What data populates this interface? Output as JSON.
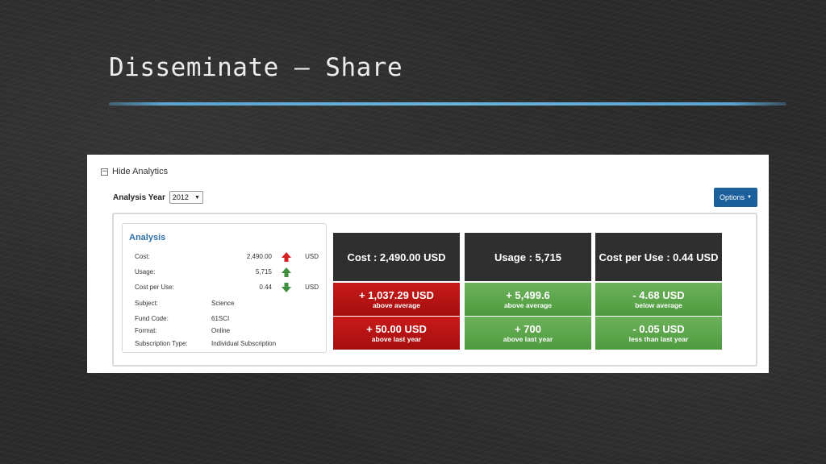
{
  "slide": {
    "title": "Disseminate – Share"
  },
  "panel": {
    "hide_analytics": "Hide Analytics",
    "analysis_year_label": "Analysis Year",
    "analysis_year_value": "2012",
    "options_label": "Options",
    "analysis": {
      "heading": "Analysis",
      "cost_label": "Cost:",
      "cost_value": "2,490.00",
      "cost_unit": "USD",
      "cost_trend": "up",
      "usage_label": "Usage:",
      "usage_value": "5,715",
      "usage_trend": "up",
      "cpu_label": "Cost per Use:",
      "cpu_value": "0.44",
      "cpu_unit": "USD",
      "cpu_trend": "down",
      "subject_label": "Subject:",
      "subject_value": "Science",
      "fund_label": "Fund Code:",
      "fund_value": "61SCI",
      "format_label": "Format:",
      "format_value": "Online",
      "subtype_label": "Subscription Type:",
      "subtype_value": "Individual Subscription"
    },
    "tiles": [
      {
        "header": "Cost : 2,490.00 USD",
        "avg_value": "+ 1,037.29 USD",
        "avg_caption": "above average",
        "year_value": "+ 50.00 USD",
        "year_caption": "above last year",
        "color": "#b41414"
      },
      {
        "header": "Usage : 5,715",
        "avg_value": "+ 5,499.6",
        "avg_caption": "above average",
        "year_value": "+ 700",
        "year_caption": "above last year",
        "color": "#5aa64a"
      },
      {
        "header": "Cost per Use : 0.44 USD",
        "avg_value": "- 4.68 USD",
        "avg_caption": "below average",
        "year_value": "- 0.05 USD",
        "year_caption": "less than last year",
        "color": "#5aa64a"
      }
    ],
    "colors": {
      "up_arrow_cost": "#d42020",
      "up_arrow_usage": "#3e8e3e",
      "down_arrow": "#3e8e3e",
      "options_button": "#1b5f9c"
    }
  }
}
